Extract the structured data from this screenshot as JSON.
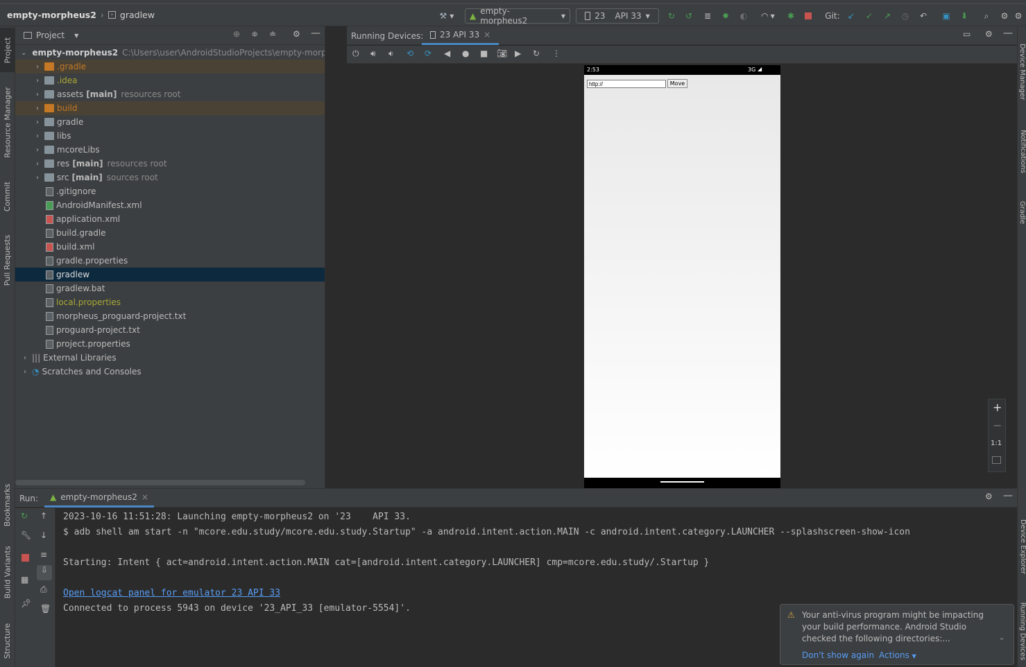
{
  "breadcrumb": {
    "project": "empty-morpheus2",
    "file": "gradlew"
  },
  "toolbar": {
    "run_config": "empty-morpheus2",
    "device_api": "23",
    "device_name": "API 33",
    "git_label": "Git:"
  },
  "left_strip": [
    "Project",
    "Resource Manager",
    "Commit",
    "Pull Requests",
    "Bookmarks",
    "Build Variants",
    "Structure"
  ],
  "right_strip": [
    "Device Manager",
    "Notifications",
    "Gradle",
    "Device Explorer",
    "Running Devices"
  ],
  "project_panel": {
    "title": "Project",
    "root": {
      "name": "empty-morpheus2",
      "path": "C:\\Users\\user\\AndroidStudioProjects\\empty-morph"
    },
    "items": [
      {
        "name": ".gradle",
        "extra": "",
        "tag": ""
      },
      {
        "name": ".idea",
        "extra": "",
        "tag": ""
      },
      {
        "name": "assets",
        "extra": "[main]",
        "tag": "resources root"
      },
      {
        "name": "build",
        "extra": "",
        "tag": ""
      },
      {
        "name": "gradle",
        "extra": "",
        "tag": ""
      },
      {
        "name": "libs",
        "extra": "",
        "tag": ""
      },
      {
        "name": "mcoreLibs",
        "extra": "",
        "tag": ""
      },
      {
        "name": "res",
        "extra": "[main]",
        "tag": "resources root"
      },
      {
        "name": "src",
        "extra": "[main]",
        "tag": "sources root"
      },
      {
        "name": ".gitignore",
        "extra": "",
        "tag": ""
      },
      {
        "name": "AndroidManifest.xml",
        "extra": "",
        "tag": ""
      },
      {
        "name": "application.xml",
        "extra": "",
        "tag": ""
      },
      {
        "name": "build.gradle",
        "extra": "",
        "tag": ""
      },
      {
        "name": "build.xml",
        "extra": "",
        "tag": ""
      },
      {
        "name": "gradle.properties",
        "extra": "",
        "tag": ""
      },
      {
        "name": "gradlew",
        "extra": "",
        "tag": ""
      },
      {
        "name": "gradlew.bat",
        "extra": "",
        "tag": ""
      },
      {
        "name": "local.properties",
        "extra": "",
        "tag": ""
      },
      {
        "name": "morpheus_proguard-project.txt",
        "extra": "",
        "tag": ""
      },
      {
        "name": "proguard-project.txt",
        "extra": "",
        "tag": ""
      },
      {
        "name": "project.properties",
        "extra": "",
        "tag": ""
      }
    ],
    "external_libraries": "External Libraries",
    "scratches": "Scratches and Consoles"
  },
  "running_devices": {
    "title": "Running Devices:",
    "tab": "23 API 33",
    "status_time": "2:53",
    "status_net": "3G",
    "url_value": "http://",
    "move_label": "Move",
    "zoom_fit_label": "1:1"
  },
  "run_panel": {
    "label": "Run:",
    "tab": "empty-morpheus2",
    "lines": [
      "2023-10-16 11:51:28: Launching empty-morpheus2 on '23    API 33.",
      "$ adb shell am start -n \"mcore.edu.study/mcore.edu.study.Startup\" -a android.intent.action.MAIN -c android.intent.category.LAUNCHER --splashscreen-show-icon",
      "",
      "Starting: Intent { act=android.intent.action.MAIN cat=[android.intent.category.LAUNCHER] cmp=mcore.edu.study/.Startup }",
      "",
      "Open logcat panel for emulator 23 API 33",
      "Connected to process 5943 on device '23_API_33 [emulator-5554]'."
    ]
  },
  "notification": {
    "message": "Your anti-virus program might be impacting your build performance. Android Studio checked the following directories:...",
    "dont_show": "Don't show again",
    "actions": "Actions"
  }
}
